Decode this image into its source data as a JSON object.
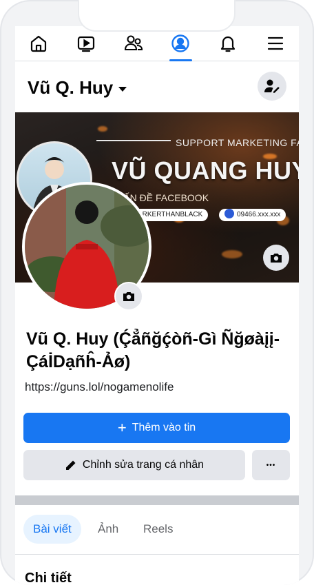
{
  "nav": {
    "items": [
      {
        "name": "home-icon"
      },
      {
        "name": "watch-icon"
      },
      {
        "name": "friends-icon"
      },
      {
        "name": "profile-icon",
        "active": true
      },
      {
        "name": "bell-icon"
      },
      {
        "name": "menu-icon"
      }
    ]
  },
  "header": {
    "title": "Vũ Q. Huy"
  },
  "cover": {
    "support_text": "SUPPORT MARKETING FACE",
    "headline": "VŨ QUANG HUY",
    "subtitle": "VẤN ĐỀ FACEBOOK",
    "handle": "/DARKERTHANBLACK",
    "phone": "09466.xxx.xxx"
  },
  "profile": {
    "full_name": "Vũ Q. Huy (Ḉẳñğḉòñ-Gì Ñğøàįį-Çáİ̇Dạñĥ-Ảø)",
    "link": "https://guns.lol/nogamenolife"
  },
  "actions": {
    "add_story_icon": "+",
    "add_story": "Thêm vào tin",
    "edit_profile": "Chỉnh sửa trang cá nhân",
    "more": "•••"
  },
  "tabs": [
    {
      "label": "Bài viết",
      "active": true
    },
    {
      "label": "Ảnh",
      "active": false
    },
    {
      "label": "Reels",
      "active": false
    }
  ],
  "section": {
    "partial_heading": "Chi tiết"
  },
  "colors": {
    "primary": "#1877f2",
    "button_grey": "#e4e6eb",
    "text": "#050505"
  }
}
